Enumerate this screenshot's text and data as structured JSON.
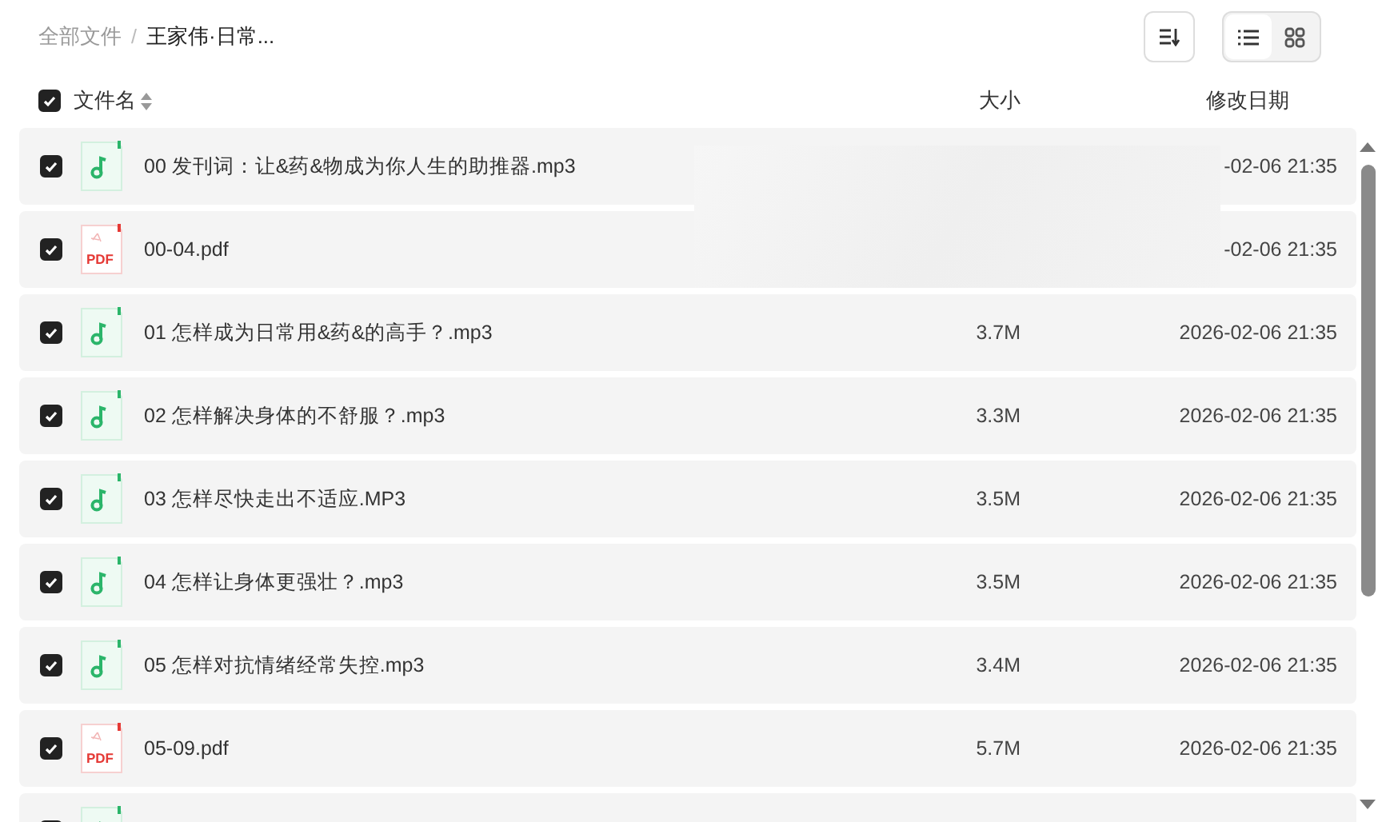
{
  "breadcrumb": [
    {
      "label": "全部文件",
      "current": false
    },
    {
      "label": "王家伟·日常...",
      "current": true
    }
  ],
  "breadcrumb_separator": "/",
  "view_modes": [
    {
      "kind": "list",
      "selected": true
    },
    {
      "kind": "grid",
      "selected": false
    }
  ],
  "header": {
    "checked": true,
    "name": "文件名",
    "size": "大小",
    "date": "修改日期"
  },
  "files": [
    {
      "kind": "audio",
      "checked": true,
      "name": "00 发刊词：让&药&物成为你人生的助推器.mp3",
      "date": "-02-06 21:35"
    },
    {
      "kind": "document",
      "icon_label": "PDF",
      "checked": true,
      "name": "00-04.pdf",
      "date": "-02-06 21:35"
    },
    {
      "kind": "audio",
      "checked": true,
      "name": "01 怎样成为日常用&药&的高手？.mp3",
      "size": "3.7M",
      "date": "2026-02-06 21:35"
    },
    {
      "kind": "audio",
      "checked": true,
      "name": "02 怎样解决身体的不舒服？.mp3",
      "size": "3.3M",
      "date": "2026-02-06 21:35"
    },
    {
      "kind": "audio",
      "checked": true,
      "name": "03 怎样尽快走出不适应.MP3",
      "size": "3.5M",
      "date": "2026-02-06 21:35"
    },
    {
      "kind": "audio",
      "checked": true,
      "name": "04 怎样让身体更强壮？.mp3",
      "size": "3.5M",
      "date": "2026-02-06 21:35"
    },
    {
      "kind": "audio",
      "checked": true,
      "name": "05 怎样对抗情绪经常失控.mp3",
      "size": "3.4M",
      "date": "2026-02-06 21:35"
    },
    {
      "kind": "document",
      "icon_label": "PDF",
      "checked": true,
      "name": "05-09.pdf",
      "size": "5.7M",
      "date": "2026-02-06 21:35"
    },
    {
      "kind": "audio",
      "checked": true
    }
  ]
}
